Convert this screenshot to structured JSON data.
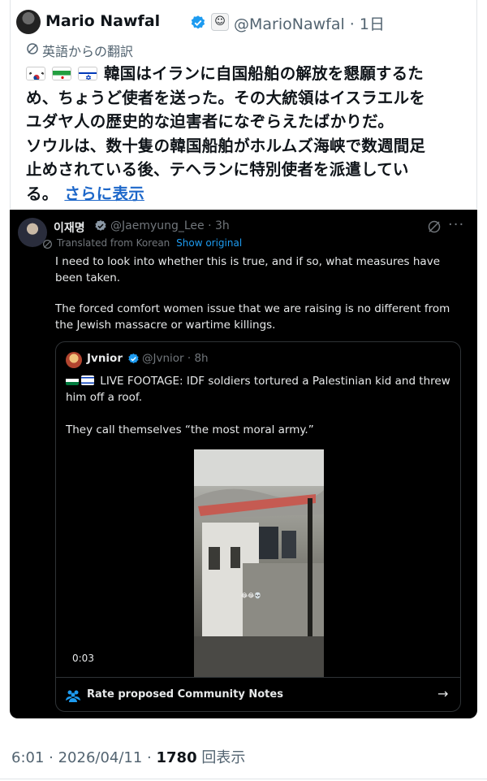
{
  "post": {
    "author_name": "Mario Nawfal",
    "handle_time": "@MarioNawfal · 1日",
    "translation_note": "英語からの翻訳",
    "flags": [
      "south-korea-flag",
      "iran-flag",
      "israel-flag"
    ],
    "text_line1": "韓国はイランに自国船舶の解放を懇願するた",
    "text_line2": "め、ちょうど使者を送った。その大統領はイスラエルを",
    "text_line3": "ユダヤ人の歴史的な迫害者になぞらえたばかりだ。",
    "text_line4": "ソウルは、数十隻の韓国船舶がホルムズ海峡で数週間足",
    "text_line5": "止めされている後、テヘランに特別使者を派遣してい",
    "text_line6": "る。",
    "show_more": "さらに表示"
  },
  "embedded": {
    "author_name": "이재명",
    "handle_time": "@Jaemyung_Lee · 3h",
    "translated_from": "Translated from Korean",
    "show_original": "Show original",
    "paragraph1": "I need to look into whether this is true, and if so, what measures have been taken.",
    "paragraph2": "The forced comfort women issue that we are raising is no different from the Jewish massacre or wartime killings.",
    "quote": {
      "author_name": "Jvnior",
      "handle_time": "@Jvnior · 8h",
      "text1": "LIVE FOOTAGE: IDF soldiers tortured a Palestinian kid and threw him off a roof.",
      "text2": "They call themselves “the most moral army.”",
      "video_time": "0:03",
      "video_caption": "😂😂💀"
    },
    "community_notes": "Rate proposed Community Notes"
  },
  "footer": {
    "time_date": "6:01 · 2026/04/11 · ",
    "views": "1780",
    "views_label": " 回表示"
  },
  "colors": {
    "link": "#1d67c9",
    "verified": "#1d9bf0"
  }
}
